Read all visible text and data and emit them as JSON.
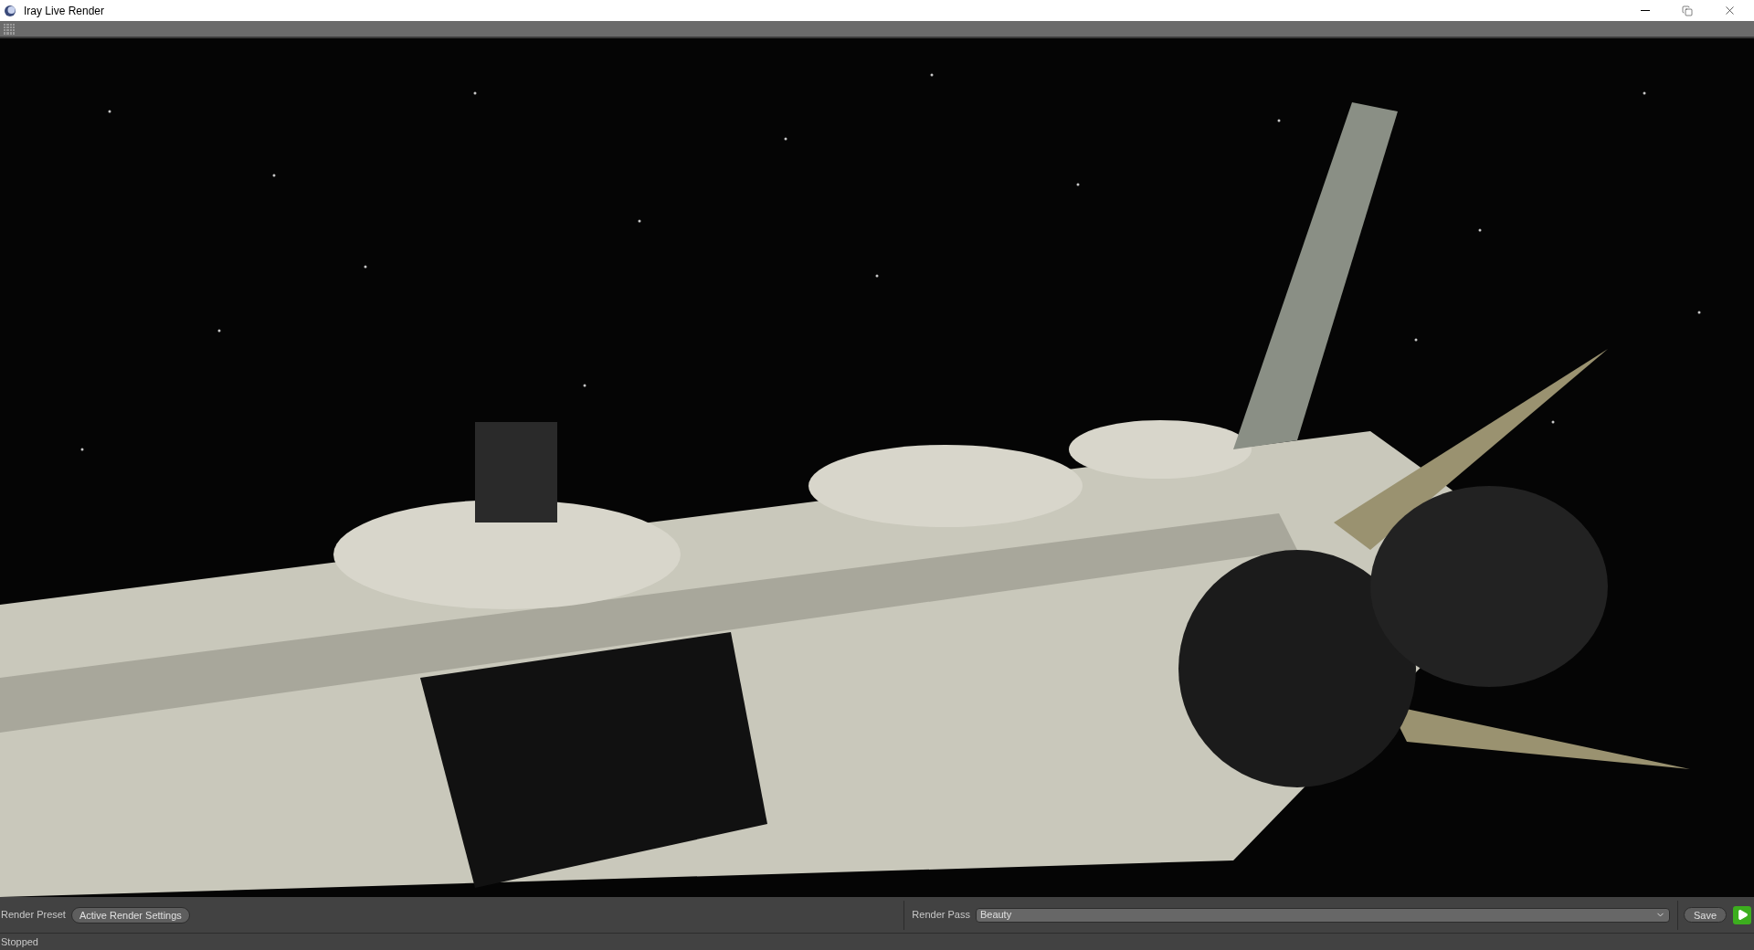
{
  "window": {
    "title": "Iray Live Render"
  },
  "bottom_bar": {
    "preset_label": "Render Preset",
    "preset_button": "Active Render Settings",
    "pass_label": "Render Pass",
    "pass_value": "Beauty",
    "save_button": "Save"
  },
  "status_bar": "Stopped"
}
